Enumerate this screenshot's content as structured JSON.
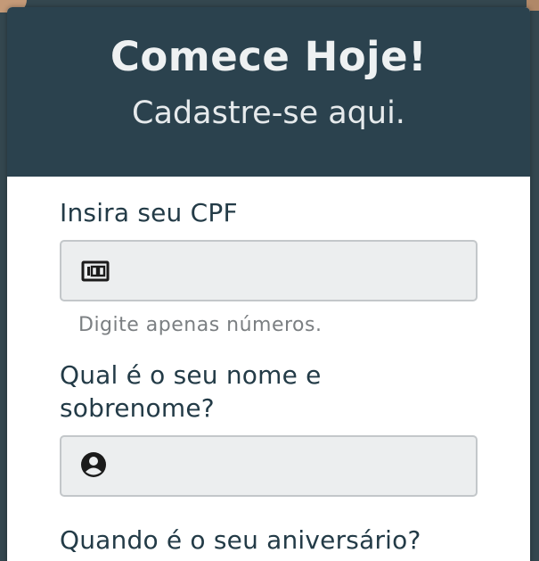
{
  "header": {
    "title": "Comece Hoje!",
    "subtitle": "Cadastre-se aqui."
  },
  "form": {
    "cpf": {
      "label": "Insira seu CPF",
      "value": "",
      "placeholder": "",
      "icon": "id-card-icon",
      "help": "Digite apenas números."
    },
    "name": {
      "label_line1": "Qual é o seu nome e",
      "label_line2": "sobrenome?",
      "value": "",
      "placeholder": "",
      "icon": "account-circle-icon"
    },
    "birthday": {
      "label": "Quando é o seu aniversário?"
    }
  },
  "colors": {
    "header_bg": "#2b424e",
    "header_text": "#eef1f2",
    "label_text": "#233b47",
    "input_bg": "#eceeef",
    "input_border": "#c3c7ca",
    "help_text": "#7b7f82"
  }
}
